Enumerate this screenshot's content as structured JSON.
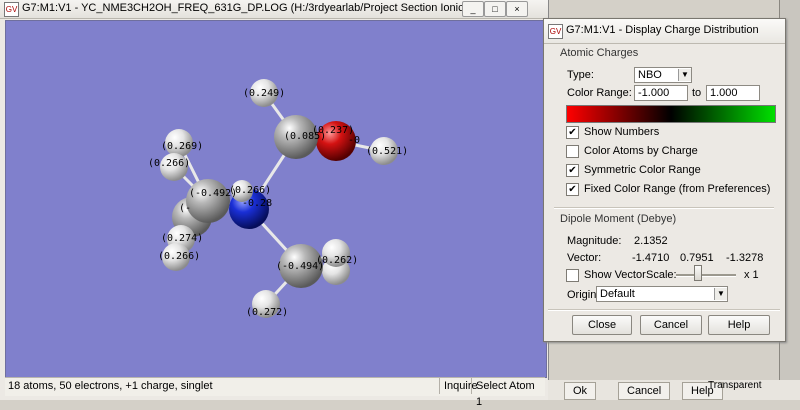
{
  "viewer": {
    "title": "G7:M1:V1 - YC_NME3CH2OH_FREQ_631G_DP.LOG (H:/3rdyearlab/Project Section Ionic Liquids/MO",
    "icon_text": "GV",
    "status": {
      "info": "18 atoms, 50 electrons, +1 charge, singlet",
      "mode": "Inquire",
      "select": "Select Atom 1"
    }
  },
  "molecule": {
    "background": "#8080cc",
    "labels": [
      {
        "id": "h-top",
        "text": "(0.249)"
      },
      {
        "id": "c-methylene",
        "text": "(0.085)"
      },
      {
        "id": "o",
        "text": "(0.237)"
      },
      {
        "id": "oh-h",
        "text": "(0.521)"
      },
      {
        "id": "o-partial",
        "text": "-0"
      },
      {
        "id": "h-left1",
        "text": "(0.269)"
      },
      {
        "id": "h-left2",
        "text": "(0.266)"
      },
      {
        "id": "c-left",
        "text": "(-0.492)"
      },
      {
        "id": "c-left-partial",
        "text": "(-"
      },
      {
        "id": "n-h",
        "text": "(0.266)"
      },
      {
        "id": "n-partial",
        "text": "-0.28"
      },
      {
        "id": "h-left3",
        "text": "(0.274)"
      },
      {
        "id": "h-left4",
        "text": "(0.266)"
      },
      {
        "id": "c-bottom",
        "text": "(-0.494)"
      },
      {
        "id": "h-bottom1",
        "text": "(0.262)"
      },
      {
        "id": "h-bottom2",
        "text": "(0.272)"
      }
    ],
    "colors": {
      "carbon": "#9a9a9a",
      "nitrogen": "#1a2fd6",
      "oxygen": "#d41212",
      "hydrogen": "#e6e6e6"
    }
  },
  "dialog": {
    "title": "G7:M1:V1 - Display Charge Distribution",
    "icon_text": "GV",
    "atomic_group": "Atomic Charges",
    "type_label": "Type:",
    "type_value": "NBO",
    "color_range_label": "Color Range:",
    "range_min": "-1.000",
    "range_to": "to",
    "range_max": "1.000",
    "gradient": [
      "#ff0000",
      "#000000",
      "#00e000"
    ],
    "checkboxes": [
      {
        "label": "Show Numbers",
        "checked": true
      },
      {
        "label": "Color Atoms by Charge",
        "checked": false
      },
      {
        "label": "Symmetric Color Range",
        "checked": true
      },
      {
        "label": "Fixed Color Range (from Preferences)",
        "checked": true
      }
    ],
    "dipole_group": "Dipole Moment (Debye)",
    "magnitude_label": "Magnitude:",
    "magnitude_value": "2.1352",
    "vector_label": "Vector:",
    "vector_x": "-1.4710",
    "vector_y": "0.7951",
    "vector_z": "-1.3278",
    "show_vector_label": "Show Vector",
    "show_vector_checked": false,
    "scale_label": "Scale:",
    "scale_suffix": "x 1",
    "origin_label": "Origin:",
    "origin_value": "Default",
    "buttons": {
      "close": "Close",
      "cancel": "Cancel",
      "help": "Help"
    }
  },
  "background": {
    "buttons": [
      "Ok",
      "Cancel",
      "Help"
    ],
    "transparent_label": "Transparent"
  },
  "window_buttons": {
    "minimize": "_",
    "maximize": "□",
    "close": "×"
  }
}
